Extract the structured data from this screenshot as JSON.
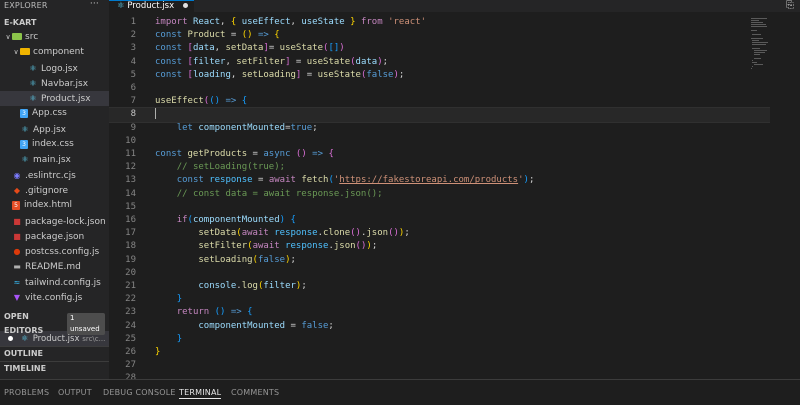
{
  "sidebar": {
    "explorer_title": "EXPLORER",
    "more_label": "···",
    "project_title": "E-KART",
    "tree": [
      {
        "label": "src",
        "kind": "folder-open",
        "depth": 0,
        "color": "#8bc34a"
      },
      {
        "label": "component",
        "kind": "folder-open",
        "depth": 1,
        "color": "#f0b400"
      },
      {
        "label": "Logo.jsx",
        "kind": "react",
        "depth": 2
      },
      {
        "label": "Navbar.jsx",
        "kind": "react",
        "depth": 2
      },
      {
        "label": "Product.jsx",
        "kind": "react",
        "depth": 2,
        "active": true
      },
      {
        "label": "App.css",
        "kind": "css",
        "depth": 1
      },
      {
        "label": "App.jsx",
        "kind": "react",
        "depth": 1
      },
      {
        "label": "index.css",
        "kind": "css",
        "depth": 1
      },
      {
        "label": "main.jsx",
        "kind": "react",
        "depth": 1
      },
      {
        "label": ".eslintrc.cjs",
        "kind": "eslint",
        "depth": 0
      },
      {
        "label": ".gitignore",
        "kind": "git",
        "depth": 0
      },
      {
        "label": "index.html",
        "kind": "html",
        "depth": 0
      },
      {
        "label": "package-lock.json",
        "kind": "npm",
        "depth": 0
      },
      {
        "label": "package.json",
        "kind": "npm",
        "depth": 0
      },
      {
        "label": "postcss.config.js",
        "kind": "postcss",
        "depth": 0
      },
      {
        "label": "README.md",
        "kind": "readme",
        "depth": 0
      },
      {
        "label": "tailwind.config.js",
        "kind": "tailwind",
        "depth": 0
      },
      {
        "label": "vite.config.js",
        "kind": "vite",
        "depth": 0
      }
    ],
    "open_editors": {
      "title": "OPEN EDITORS",
      "badge": "1 unsaved",
      "file": "Product.jsx",
      "path": "src\\c..."
    },
    "outline_title": "OUTLINE",
    "timeline_title": "TIMELINE"
  },
  "tab": {
    "label": "Product.jsx"
  },
  "editor": {
    "current_line": 8,
    "lines": [
      [
        [
          "kw",
          "import"
        ],
        [
          "txt",
          " "
        ],
        [
          "var",
          "React"
        ],
        [
          "txt",
          ", "
        ],
        [
          "b1",
          "{"
        ],
        [
          "txt",
          " "
        ],
        [
          "var",
          "useEffect"
        ],
        [
          "txt",
          ", "
        ],
        [
          "var",
          "useState"
        ],
        [
          "txt",
          " "
        ],
        [
          "b1",
          "}"
        ],
        [
          "txt",
          " "
        ],
        [
          "kw",
          "from"
        ],
        [
          "txt",
          " "
        ],
        [
          "str",
          "'react'"
        ]
      ],
      [
        [
          "dkw",
          "const"
        ],
        [
          "txt",
          " "
        ],
        [
          "fn",
          "Product"
        ],
        [
          "txt",
          " = "
        ],
        [
          "b1",
          "("
        ],
        [
          "b1",
          ")"
        ],
        [
          "txt",
          " "
        ],
        [
          "dkw",
          "=>"
        ],
        [
          "txt",
          " "
        ],
        [
          "b1",
          "{"
        ]
      ],
      [
        [
          "dkw",
          "const"
        ],
        [
          "txt",
          " "
        ],
        [
          "b2",
          "["
        ],
        [
          "var",
          "data"
        ],
        [
          "txt",
          ", "
        ],
        [
          "fn",
          "setData"
        ],
        [
          "b2",
          "]"
        ],
        [
          "txt",
          "= "
        ],
        [
          "fn",
          "useState"
        ],
        [
          "b2",
          "("
        ],
        [
          "b3",
          "[]"
        ],
        [
          "b2",
          ")"
        ]
      ],
      [
        [
          "dkw",
          "const"
        ],
        [
          "txt",
          " "
        ],
        [
          "b2",
          "["
        ],
        [
          "var",
          "filter"
        ],
        [
          "txt",
          ", "
        ],
        [
          "fn",
          "setFilter"
        ],
        [
          "b2",
          "]"
        ],
        [
          "txt",
          " = "
        ],
        [
          "fn",
          "useState"
        ],
        [
          "b2",
          "("
        ],
        [
          "var",
          "data"
        ],
        [
          "b2",
          ")"
        ],
        [
          "txt",
          ";"
        ]
      ],
      [
        [
          "dkw",
          "const"
        ],
        [
          "txt",
          " "
        ],
        [
          "b2",
          "["
        ],
        [
          "var",
          "loading"
        ],
        [
          "txt",
          ", "
        ],
        [
          "fn",
          "setLoading"
        ],
        [
          "b2",
          "]"
        ],
        [
          "txt",
          " = "
        ],
        [
          "fn",
          "useState"
        ],
        [
          "b2",
          "("
        ],
        [
          "dkw",
          "false"
        ],
        [
          "b2",
          ")"
        ],
        [
          "txt",
          ";"
        ]
      ],
      [],
      [
        [
          "fn",
          "useEffect"
        ],
        [
          "b2",
          "("
        ],
        [
          "b3",
          "("
        ],
        [
          "b3",
          ")"
        ],
        [
          "txt",
          " "
        ],
        [
          "dkw",
          "=>"
        ],
        [
          "txt",
          " "
        ],
        [
          "b3",
          "{"
        ]
      ],
      [
        [
          "caret",
          ""
        ]
      ],
      [
        [
          "txt",
          "    "
        ],
        [
          "dkw",
          "let"
        ],
        [
          "txt",
          " "
        ],
        [
          "var",
          "componentMounted"
        ],
        [
          "txt",
          "="
        ],
        [
          "dkw",
          "true"
        ],
        [
          "txt",
          ";"
        ]
      ],
      [],
      [
        [
          "dkw",
          "const"
        ],
        [
          "txt",
          " "
        ],
        [
          "fn",
          "getProducts"
        ],
        [
          "txt",
          " = "
        ],
        [
          "dkw",
          "async"
        ],
        [
          "txt",
          " "
        ],
        [
          "b2",
          "("
        ],
        [
          "b2",
          ")"
        ],
        [
          "txt",
          " "
        ],
        [
          "dkw",
          "=>"
        ],
        [
          "txt",
          " "
        ],
        [
          "b2",
          "{"
        ]
      ],
      [
        [
          "txt",
          "    "
        ],
        [
          "com",
          "// setLoading(true);"
        ]
      ],
      [
        [
          "txt",
          "    "
        ],
        [
          "dkw",
          "const"
        ],
        [
          "txt",
          " "
        ],
        [
          "cst",
          "response"
        ],
        [
          "txt",
          " = "
        ],
        [
          "kw",
          "await"
        ],
        [
          "txt",
          " "
        ],
        [
          "fn",
          "fetch"
        ],
        [
          "b3",
          "("
        ],
        [
          "str",
          "'"
        ],
        [
          "url",
          "https://fakestoreapi.com/products"
        ],
        [
          "str",
          "'"
        ],
        [
          "b3",
          ")"
        ],
        [
          "txt",
          ";"
        ]
      ],
      [
        [
          "txt",
          "    "
        ],
        [
          "com",
          "// const data = await response.json();"
        ]
      ],
      [],
      [
        [
          "txt",
          "    "
        ],
        [
          "kw",
          "if"
        ],
        [
          "b3",
          "("
        ],
        [
          "var",
          "componentMounted"
        ],
        [
          "b3",
          ")"
        ],
        [
          "txt",
          " "
        ],
        [
          "b3",
          "{"
        ]
      ],
      [
        [
          "txt",
          "        "
        ],
        [
          "fn",
          "setData"
        ],
        [
          "b1",
          "("
        ],
        [
          "kw",
          "await"
        ],
        [
          "txt",
          " "
        ],
        [
          "cst",
          "response"
        ],
        [
          "txt",
          "."
        ],
        [
          "fn",
          "clone"
        ],
        [
          "b2",
          "("
        ],
        [
          "b2",
          ")"
        ],
        [
          "txt",
          "."
        ],
        [
          "fn",
          "json"
        ],
        [
          "b2",
          "("
        ],
        [
          "b2",
          ")"
        ],
        [
          "b1",
          ")"
        ],
        [
          "txt",
          ";"
        ]
      ],
      [
        [
          "txt",
          "        "
        ],
        [
          "fn",
          "setFilter"
        ],
        [
          "b1",
          "("
        ],
        [
          "kw",
          "await"
        ],
        [
          "txt",
          " "
        ],
        [
          "cst",
          "response"
        ],
        [
          "txt",
          "."
        ],
        [
          "fn",
          "json"
        ],
        [
          "b2",
          "("
        ],
        [
          "b2",
          ")"
        ],
        [
          "b1",
          ")"
        ],
        [
          "txt",
          ";"
        ]
      ],
      [
        [
          "txt",
          "        "
        ],
        [
          "fn",
          "setLoading"
        ],
        [
          "b1",
          "("
        ],
        [
          "dkw",
          "false"
        ],
        [
          "b1",
          ")"
        ],
        [
          "txt",
          ";"
        ]
      ],
      [],
      [
        [
          "txt",
          "        "
        ],
        [
          "var",
          "console"
        ],
        [
          "txt",
          "."
        ],
        [
          "fn",
          "log"
        ],
        [
          "b1",
          "("
        ],
        [
          "var",
          "filter"
        ],
        [
          "b1",
          ")"
        ],
        [
          "txt",
          ";"
        ]
      ],
      [
        [
          "txt",
          "    "
        ],
        [
          "b3",
          "}"
        ]
      ],
      [
        [
          "txt",
          "    "
        ],
        [
          "kw",
          "return"
        ],
        [
          "txt",
          " "
        ],
        [
          "b3",
          "("
        ],
        [
          "b3",
          ")"
        ],
        [
          "txt",
          " "
        ],
        [
          "dkw",
          "=>"
        ],
        [
          "txt",
          " "
        ],
        [
          "b3",
          "{"
        ]
      ],
      [
        [
          "txt",
          "        "
        ],
        [
          "var",
          "componentMounted"
        ],
        [
          "txt",
          " = "
        ],
        [
          "dkw",
          "false"
        ],
        [
          "txt",
          ";"
        ]
      ],
      [
        [
          "txt",
          "    "
        ],
        [
          "b3",
          "}"
        ]
      ],
      [
        [
          "b1",
          "}"
        ]
      ],
      [],
      []
    ]
  },
  "panel": {
    "tabs": [
      {
        "label": "PROBLEMS",
        "active": false
      },
      {
        "label": "OUTPUT",
        "active": false
      },
      {
        "label": "DEBUG CONSOLE",
        "active": false
      },
      {
        "label": "TERMINAL",
        "active": true
      },
      {
        "label": "COMMENTS",
        "active": false
      }
    ]
  }
}
